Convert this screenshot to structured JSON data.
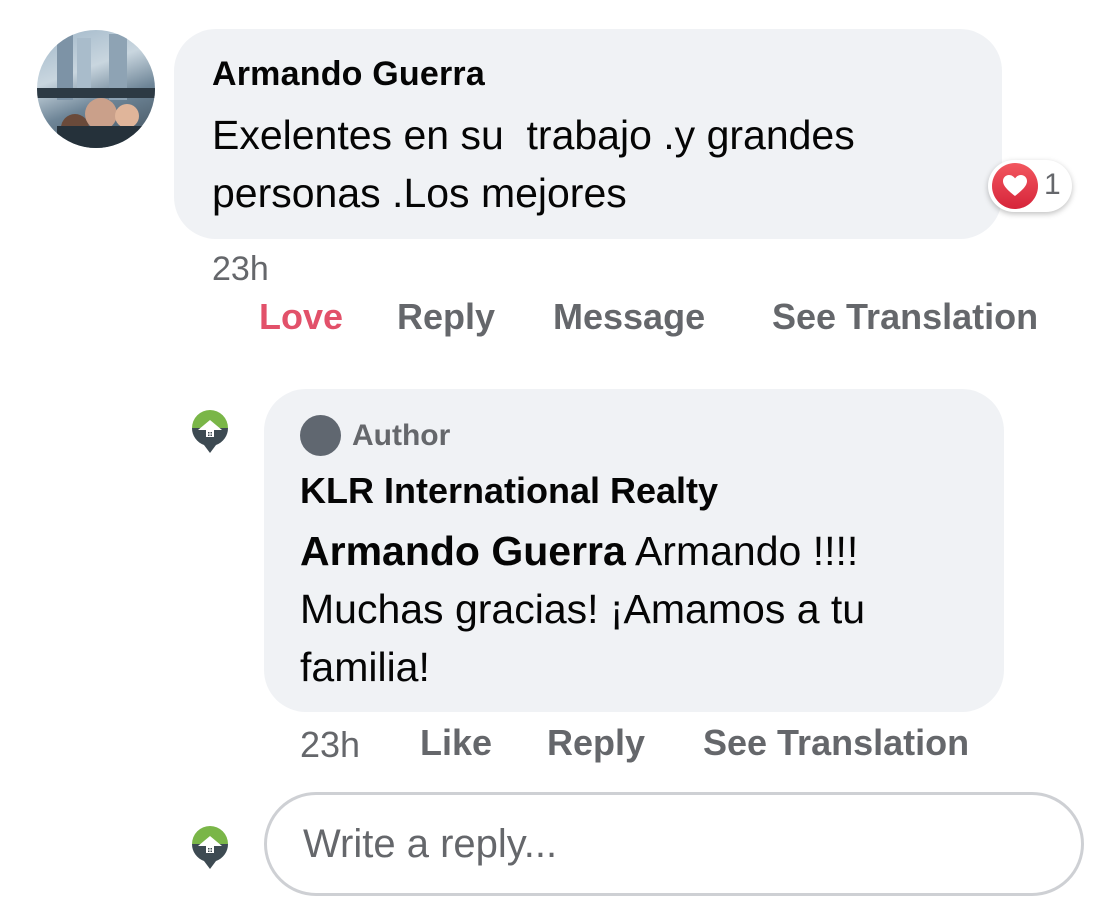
{
  "comment": {
    "author": "Armando Guerra",
    "text": "Exelentes en su  trabajo .y grandes\npersonas .Los mejores",
    "reaction_count": "1",
    "reaction_icon": "heart-icon",
    "time": "23h",
    "actions": {
      "love": "Love",
      "reply": "Reply",
      "message": "Message",
      "translate": "See Translation"
    }
  },
  "reply": {
    "badge": "Author",
    "author": "KLR International Realty",
    "mention": "Armando Guerra",
    "text": " Armando !!!! Muchas gracias! ¡Amamos a tu familia!",
    "time": "23h",
    "actions": {
      "like": "Like",
      "reply": "Reply",
      "translate": "See Translation"
    }
  },
  "composer": {
    "placeholder": "Write a reply..."
  },
  "colors": {
    "bubble": "#f0f2f5",
    "love": "#e2516a",
    "muted": "#65676b",
    "brand_green": "#7ab648",
    "brand_dark": "#3d4a52"
  }
}
